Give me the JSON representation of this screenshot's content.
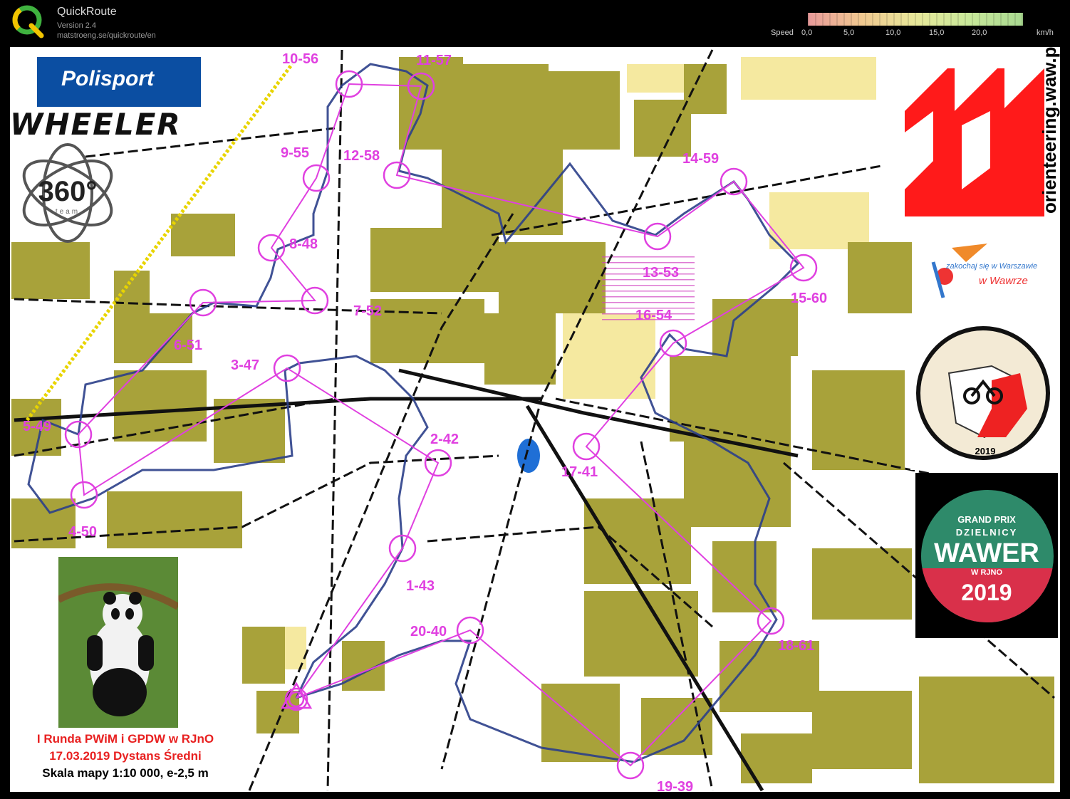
{
  "app": {
    "title": "QuickRoute",
    "version": "Version 2.4",
    "url": "matstroeng.se/quickroute/en"
  },
  "speed_legend": {
    "label": "Speed",
    "ticks": [
      "0,0",
      "5,0",
      "10,0",
      "15,0",
      "20,0"
    ],
    "unit": "km/h",
    "colors": {
      "slow": "#e89a9a",
      "mid": "#e8e89a",
      "fast": "#a8d890"
    }
  },
  "map": {
    "colors": {
      "forest": "#a8a23a",
      "open": "#f5e9a0",
      "course": "#e040e0",
      "route": "#2b3f8a",
      "water": "#1f6fd6",
      "track": "#111111"
    },
    "controls": [
      "1-43",
      "2-42",
      "3-47",
      "4-50",
      "5-49",
      "6-51",
      "7-52",
      "8-48",
      "9-55",
      "10-56",
      "11-57",
      "12-58",
      "13-53",
      "14-59",
      "15-60",
      "16-54",
      "17-41",
      "18-61",
      "19-39",
      "20-40"
    ]
  },
  "sponsors": {
    "polisport": "Polisport",
    "wheeler": "WHEELER",
    "team360": "360°",
    "team360_sub": "team",
    "orienteering": "orienteering.waw.pl",
    "wawrze_small": "zakochaj się w Warszawie",
    "wawrze": "w Wawrze",
    "puchar_year": "2019",
    "gp_line1": "GRAND PRIX",
    "gp_line2": "DZIELNICY",
    "gp_wawer": "WAWER",
    "gp_rjno": "W RJNO",
    "gp_year": "2019"
  },
  "caption": {
    "line1": "I Runda PWiM i GPDW w RJnO",
    "line2": "17.03.2019 Dystans Średni",
    "line3": "Skala mapy 1:10 000, e-2,5 m"
  }
}
